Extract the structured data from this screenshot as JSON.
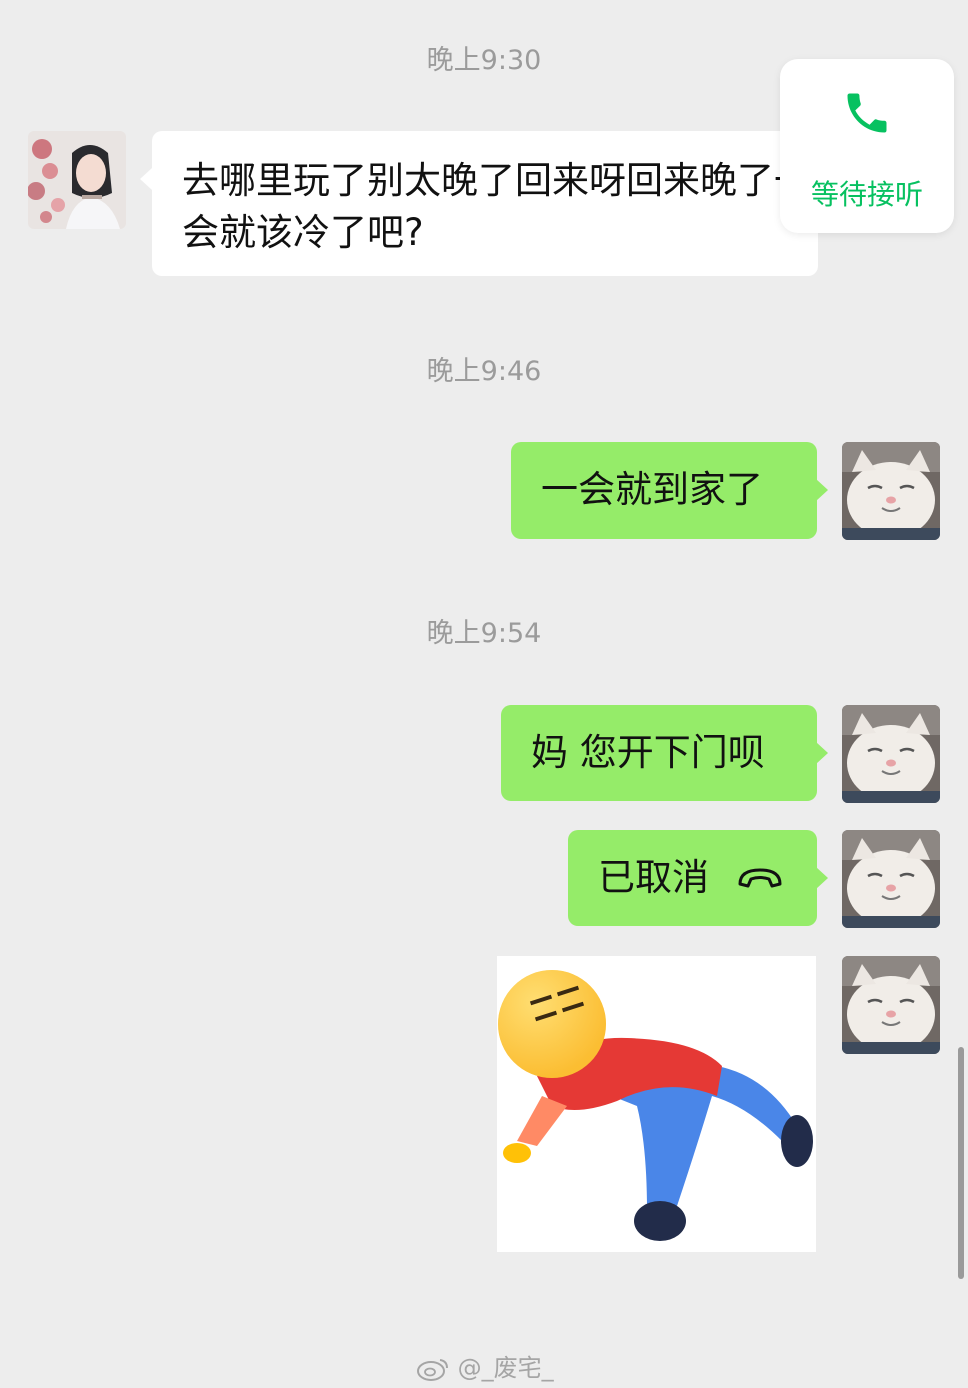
{
  "call_card": {
    "icon": "phone-icon",
    "label": "等待接听",
    "accent": "#07c160"
  },
  "messages": [
    {
      "time": "晚上9:30",
      "text": "去哪里玩了别太晚了回来呀回来晚了一会就该冷了吧?"
    },
    {
      "time": "晚上9:46",
      "text": "一会就到家了"
    },
    {
      "time": "晚上9:54",
      "text": "妈 您开下门呗"
    },
    {
      "text": "已取消",
      "icon": "hang-up-icon"
    },
    {
      "sticker": "lying-emoji-sticker"
    }
  ],
  "watermark": "@_废宅_",
  "colors": {
    "background": "#ededed",
    "outgoing_bubble": "#95ec69",
    "incoming_bubble": "#ffffff",
    "timestamp": "#9b9b9b"
  }
}
